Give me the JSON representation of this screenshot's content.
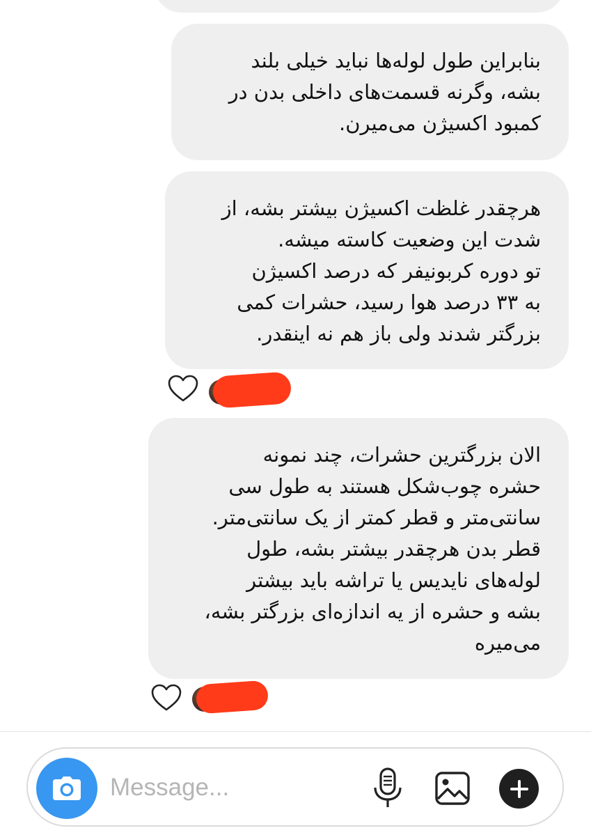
{
  "messages": [
    {
      "text": ""
    },
    {
      "text": "بنابراین طول لوله‌ها نباید خیلی بلند\nبشه، وگرنه قسمت‌های داخلی بدن در\nکمبود اکسیژن می‌میرن."
    },
    {
      "text": "هرچقدر غلظت اکسیژن بیشتر بشه، از\nشدت این وضعیت کاسته میشه.\nتو دوره کربونیفر که درصد اکسیژن\nبه ۳۳ درصد هوا رسید، حشرات کمی\nبزرگتر شدند ولی باز هم نه اینقدر."
    },
    {
      "text": "الان بزرگترین حشرات، چند نمونه\nحشره چوب‌شکل هستند به طول سی\nسانتی‌متر و قطر کمتر از یک سانتی‌متر.\nقطر بدن هرچقدر بیشتر بشه، طول\nلوله‌های نایدیس یا تراشه باید بیشتر\nبشه و حشره از یه اندازه‌ای بزرگتر بشه،\nمی‌میره"
    }
  ],
  "reactions": [
    {
      "icon": "heart-outline-icon",
      "reactor": "redacted-avatar",
      "redaction_color": "#ff3b1a"
    },
    {
      "icon": "heart-outline-icon",
      "reactor": "redacted-avatar",
      "redaction_color": "#ff3b1a"
    }
  ],
  "composer": {
    "placeholder": "Message...",
    "camera_icon": "camera-icon",
    "camera_color": "#3897f0",
    "mic_icon": "microphone-icon",
    "gallery_icon": "image-gallery-icon",
    "add_icon": "plus-circle-icon"
  },
  "colors": {
    "bubble_bg": "#efefef",
    "text": "#111111",
    "background": "#ffffff"
  }
}
